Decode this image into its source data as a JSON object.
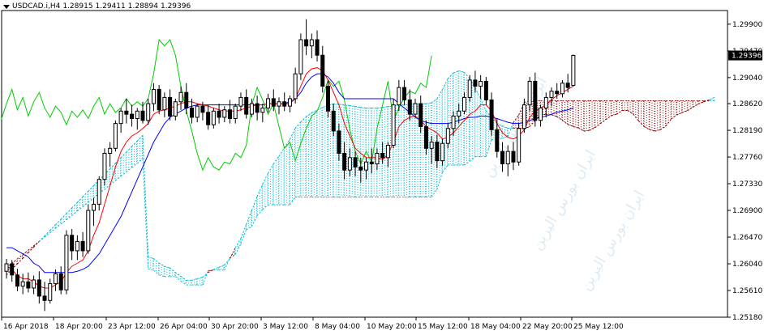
{
  "symbol_header": {
    "symbol": "USDCAD.i,H4",
    "open": "1.28915",
    "high": "1.29411",
    "low": "1.28894",
    "close": "1.29396"
  },
  "price_badge": "1.29396",
  "watermark_text": "ایران بورس الیرین",
  "colors": {
    "bull_candle": "#000000",
    "bear_candle": "#000000",
    "tenkan": "#ff0000",
    "kijun": "#0000ff",
    "chikou": "#00cc00",
    "kumo_bull": "#00bcd4",
    "kumo_bear": "#8b0000",
    "price_badge_bg": "#000000"
  },
  "chart_data": {
    "type": "candlestick",
    "indicator": "Ichimoku Kinko Hyo",
    "y_axis": {
      "min": 1.2518,
      "max": 1.3012,
      "ticks": [
        "1.29900",
        "1.29470",
        "1.29040",
        "1.28620",
        "1.28190",
        "1.27760",
        "1.27330",
        "1.26900",
        "1.26470",
        "1.26040",
        "1.25610",
        "1.25180"
      ]
    },
    "x_axis": {
      "ticks": [
        "16 Apr 2018",
        "18 Apr 20:00",
        "23 Apr 12:00",
        "26 Apr 04:00",
        "30 Apr 20:00",
        "3 May 12:00",
        "8 May 04:00",
        "10 May 20:00",
        "15 May 12:00",
        "18 May 04:00",
        "22 May 20:00",
        "25 May 12:00"
      ]
    },
    "candles": [
      [
        1.2592,
        1.2612,
        1.258,
        1.2604
      ],
      [
        1.2604,
        1.261,
        1.2575,
        1.2586
      ],
      [
        1.2586,
        1.2596,
        1.256,
        1.2568
      ],
      [
        1.2568,
        1.2588,
        1.2555,
        1.2575
      ],
      [
        1.2575,
        1.259,
        1.2558,
        1.2565
      ],
      [
        1.2565,
        1.2585,
        1.2555,
        1.2578
      ],
      [
        1.2578,
        1.2592,
        1.254,
        1.2552
      ],
      [
        1.2552,
        1.2575,
        1.2528,
        1.2545
      ],
      [
        1.2545,
        1.258,
        1.254,
        1.2572
      ],
      [
        1.2572,
        1.2595,
        1.256,
        1.2588
      ],
      [
        1.2588,
        1.26,
        1.2555,
        1.2562
      ],
      [
        1.2562,
        1.2658,
        1.2555,
        1.265
      ],
      [
        1.265,
        1.266,
        1.261,
        1.2625
      ],
      [
        1.2625,
        1.265,
        1.261,
        1.264
      ],
      [
        1.264,
        1.2655,
        1.2615,
        1.2625
      ],
      [
        1.2625,
        1.27,
        1.262,
        1.269
      ],
      [
        1.269,
        1.271,
        1.2665,
        1.27
      ],
      [
        1.27,
        1.2745,
        1.269,
        1.274
      ],
      [
        1.274,
        1.279,
        1.273,
        1.2782
      ],
      [
        1.2782,
        1.28,
        1.276,
        1.279
      ],
      [
        1.279,
        1.2835,
        1.2785,
        1.283
      ],
      [
        1.283,
        1.2855,
        1.2815,
        1.285
      ],
      [
        1.285,
        1.287,
        1.283,
        1.2845
      ],
      [
        1.2845,
        1.286,
        1.2825,
        1.2838
      ],
      [
        1.2838,
        1.2855,
        1.282,
        1.285
      ],
      [
        1.285,
        1.2865,
        1.283,
        1.2835
      ],
      [
        1.2835,
        1.287,
        1.2828,
        1.2862
      ],
      [
        1.2862,
        1.2895,
        1.285,
        1.2885
      ],
      [
        1.2885,
        1.2892,
        1.2845,
        1.2852
      ],
      [
        1.2852,
        1.288,
        1.284,
        1.2872
      ],
      [
        1.2872,
        1.2885,
        1.2835,
        1.2842
      ],
      [
        1.2842,
        1.287,
        1.2835,
        1.2865
      ],
      [
        1.2865,
        1.289,
        1.2852,
        1.288
      ],
      [
        1.288,
        1.2895,
        1.2845,
        1.2855
      ],
      [
        1.2855,
        1.287,
        1.283,
        1.284
      ],
      [
        1.284,
        1.2862,
        1.2832,
        1.2858
      ],
      [
        1.2858,
        1.2865,
        1.2835,
        1.2848
      ],
      [
        1.2848,
        1.286,
        1.282,
        1.2828
      ],
      [
        1.2828,
        1.2855,
        1.2822,
        1.285
      ],
      [
        1.285,
        1.2862,
        1.283,
        1.284
      ],
      [
        1.284,
        1.2858,
        1.2832,
        1.2852
      ],
      [
        1.2852,
        1.2868,
        1.283,
        1.2838
      ],
      [
        1.2838,
        1.2862,
        1.283,
        1.2858
      ],
      [
        1.2858,
        1.288,
        1.285,
        1.2872
      ],
      [
        1.2872,
        1.2885,
        1.2838,
        1.2845
      ],
      [
        1.2845,
        1.287,
        1.284,
        1.2862
      ],
      [
        1.2862,
        1.2875,
        1.2835,
        1.2848
      ],
      [
        1.2848,
        1.2862,
        1.2832,
        1.2855
      ],
      [
        1.2855,
        1.2878,
        1.2848,
        1.287
      ],
      [
        1.287,
        1.2885,
        1.285,
        1.2858
      ],
      [
        1.2858,
        1.2872,
        1.2845,
        1.2865
      ],
      [
        1.2865,
        1.288,
        1.285,
        1.2858
      ],
      [
        1.2858,
        1.2875,
        1.2848,
        1.287
      ],
      [
        1.287,
        1.292,
        1.2862,
        1.291
      ],
      [
        1.291,
        1.2975,
        1.29,
        1.2965
      ],
      [
        1.2965,
        1.2998,
        1.294,
        1.2955
      ],
      [
        1.2955,
        1.2975,
        1.2935,
        1.2965
      ],
      [
        1.2965,
        1.298,
        1.293,
        1.294
      ],
      [
        1.294,
        1.2955,
        1.288,
        1.289
      ],
      [
        1.289,
        1.29,
        1.284,
        1.285
      ],
      [
        1.285,
        1.2862,
        1.281,
        1.2818
      ],
      [
        1.2818,
        1.283,
        1.277,
        1.2782
      ],
      [
        1.2782,
        1.28,
        1.274,
        1.2755
      ],
      [
        1.2755,
        1.279,
        1.2745,
        1.2775
      ],
      [
        1.2775,
        1.2785,
        1.2745,
        1.276
      ],
      [
        1.276,
        1.2775,
        1.2735,
        1.2755
      ],
      [
        1.2755,
        1.2775,
        1.274,
        1.2768
      ],
      [
        1.2768,
        1.279,
        1.275,
        1.2765
      ],
      [
        1.2765,
        1.279,
        1.2755,
        1.2782
      ],
      [
        1.2782,
        1.28,
        1.2765,
        1.2775
      ],
      [
        1.2775,
        1.28,
        1.276,
        1.2795
      ],
      [
        1.2795,
        1.287,
        1.279,
        1.286
      ],
      [
        1.286,
        1.29,
        1.285,
        1.2888
      ],
      [
        1.2888,
        1.29,
        1.286,
        1.2868
      ],
      [
        1.2868,
        1.2885,
        1.2835,
        1.2845
      ],
      [
        1.2845,
        1.287,
        1.284,
        1.2862
      ],
      [
        1.2862,
        1.2875,
        1.2815,
        1.2825
      ],
      [
        1.2825,
        1.2835,
        1.278,
        1.279
      ],
      [
        1.279,
        1.281,
        1.2765,
        1.28
      ],
      [
        1.28,
        1.2812,
        1.2758,
        1.277
      ],
      [
        1.277,
        1.2805,
        1.2762,
        1.2798
      ],
      [
        1.2798,
        1.283,
        1.279,
        1.2822
      ],
      [
        1.2822,
        1.285,
        1.281,
        1.2842
      ],
      [
        1.2842,
        1.2862,
        1.283,
        1.285
      ],
      [
        1.285,
        1.288,
        1.2845,
        1.2872
      ],
      [
        1.2872,
        1.2908,
        1.2865,
        1.29
      ],
      [
        1.29,
        1.2915,
        1.288,
        1.289
      ],
      [
        1.289,
        1.2908,
        1.287,
        1.2898
      ],
      [
        1.2898,
        1.2905,
        1.286,
        1.2868
      ],
      [
        1.2868,
        1.288,
        1.281,
        1.282
      ],
      [
        1.282,
        1.2838,
        1.2775,
        1.2785
      ],
      [
        1.2785,
        1.28,
        1.2752,
        1.2765
      ],
      [
        1.2765,
        1.2795,
        1.2745,
        1.2785
      ],
      [
        1.2785,
        1.28,
        1.2755,
        1.2768
      ],
      [
        1.2768,
        1.283,
        1.2762,
        1.2822
      ],
      [
        1.2822,
        1.287,
        1.2815,
        1.286
      ],
      [
        1.286,
        1.2905,
        1.285,
        1.2898
      ],
      [
        1.2898,
        1.2912,
        1.2825,
        1.2835
      ],
      [
        1.2835,
        1.286,
        1.2825,
        1.2855
      ],
      [
        1.2855,
        1.288,
        1.284,
        1.2872
      ],
      [
        1.2872,
        1.2888,
        1.2858,
        1.2882
      ],
      [
        1.2882,
        1.2895,
        1.287,
        1.2878
      ],
      [
        1.2878,
        1.29,
        1.2872,
        1.2895
      ],
      [
        1.2895,
        1.291,
        1.288,
        1.2888
      ],
      [
        1.28915,
        1.29411,
        1.28894,
        1.29396
      ]
    ],
    "tenkan": [
      1.26,
      1.2595,
      1.2585,
      1.258,
      1.258,
      1.2575,
      1.2568,
      1.2565,
      1.2565,
      1.257,
      1.2575,
      1.259,
      1.26,
      1.2605,
      1.261,
      1.2625,
      1.265,
      1.267,
      1.27,
      1.273,
      1.276,
      1.2785,
      1.28,
      1.281,
      1.2815,
      1.2822,
      1.283,
      1.2845,
      1.285,
      1.2852,
      1.2855,
      1.2858,
      1.2862,
      1.2865,
      1.2865,
      1.2862,
      1.286,
      1.2858,
      1.2855,
      1.2852,
      1.285,
      1.285,
      1.285,
      1.2852,
      1.2855,
      1.2858,
      1.286,
      1.286,
      1.2862,
      1.2862,
      1.2862,
      1.2862,
      1.2862,
      1.287,
      1.289,
      1.291,
      1.2918,
      1.292,
      1.2915,
      1.29,
      1.288,
      1.286,
      1.283,
      1.281,
      1.279,
      1.2782,
      1.2775,
      1.2775,
      1.2775,
      1.2772,
      1.278,
      1.28,
      1.2825,
      1.2835,
      1.284,
      1.2842,
      1.2835,
      1.2825,
      1.282,
      1.2815,
      1.2805,
      1.2808,
      1.2815,
      1.2825,
      1.2835,
      1.2845,
      1.285,
      1.286,
      1.286,
      1.285,
      1.283,
      1.2815,
      1.2808,
      1.2805,
      1.281,
      1.282,
      1.284,
      1.285,
      1.2855,
      1.286,
      1.2868,
      1.2875,
      1.288,
      1.2885,
      1.289
    ],
    "kijun": [
      1.263,
      1.263,
      1.2625,
      1.262,
      1.2615,
      1.2605,
      1.26,
      1.259,
      1.259,
      1.259,
      1.259,
      1.259,
      1.259,
      1.2592,
      1.2595,
      1.26,
      1.261,
      1.262,
      1.2635,
      1.265,
      1.2665,
      1.268,
      1.27,
      1.272,
      1.274,
      1.276,
      1.278,
      1.28,
      1.2815,
      1.283,
      1.284,
      1.2845,
      1.285,
      1.2855,
      1.2858,
      1.286,
      1.286,
      1.286,
      1.286,
      1.286,
      1.286,
      1.286,
      1.286,
      1.286,
      1.286,
      1.286,
      1.286,
      1.286,
      1.2862,
      1.2862,
      1.2862,
      1.2862,
      1.2865,
      1.287,
      1.288,
      1.2895,
      1.2905,
      1.291,
      1.291,
      1.2905,
      1.2895,
      1.288,
      1.287,
      1.287,
      1.287,
      1.287,
      1.287,
      1.287,
      1.287,
      1.287,
      1.287,
      1.287,
      1.2862,
      1.2855,
      1.2848,
      1.284,
      1.2835,
      1.2832,
      1.283,
      1.283,
      1.283,
      1.283,
      1.2832,
      1.2835,
      1.2838,
      1.284,
      1.284,
      1.2842,
      1.2842,
      1.284,
      1.2838,
      1.2835,
      1.2832,
      1.283,
      1.283,
      1.2832,
      1.2835,
      1.2838,
      1.284,
      1.2842,
      1.2845,
      1.2848,
      1.285,
      1.2852,
      1.2855
    ]
  }
}
